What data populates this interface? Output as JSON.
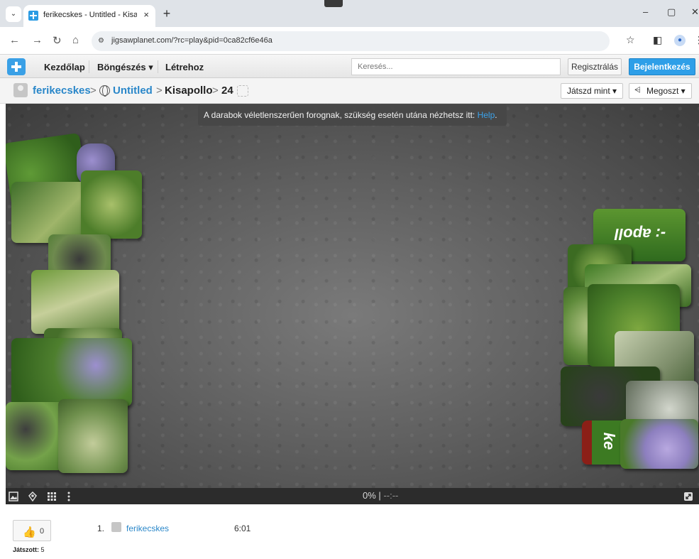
{
  "browser": {
    "tab_title": "ferikecskes - Untitled - Kisapollo",
    "tab_close": "×",
    "new_tab": "+",
    "url": "jigsawplanet.com/?rc=play&pid=0ca82cf6e46a",
    "window_minimize": "–",
    "window_restore": "▢",
    "window_close": "✕"
  },
  "site_nav": {
    "links": [
      "Kezdőlap",
      "Böngészés ▾",
      "Létrehoz"
    ],
    "search_placeholder": "Keresés...",
    "register_label": "Regisztrálás",
    "login_label": "Bejelentkezés"
  },
  "breadcrumb": {
    "user": "ferikecskes",
    "album": "Untitled",
    "puzzle": "Kisapollo",
    "pieces": "24",
    "separator": ">",
    "play_as_label": "Játszd mint ▾",
    "share_label": "Megoszt ▾"
  },
  "board": {
    "hint_text": "A darabok véletlenszerűen forognak, szükség esetén utána nézhetsz itt: ",
    "hint_link": "Help",
    "hint_end": ".",
    "piece_text_1": "-: apoll",
    "piece_text_2": "ke",
    "background_color": "#5f5f5f"
  },
  "toolbar": {
    "progress": "0%",
    "separator": "|",
    "timer": "--:--"
  },
  "footer": {
    "like_count": "0",
    "played_label": "Játszott:",
    "played_count": "5",
    "leaderboard": [
      {
        "rank": "1.",
        "user": "ferikecskes",
        "time": "6:01"
      }
    ]
  },
  "colors": {
    "accent_blue": "#2e9fe8",
    "link_blue": "#2a87c9",
    "leaf_green": "#4f8a2c"
  }
}
